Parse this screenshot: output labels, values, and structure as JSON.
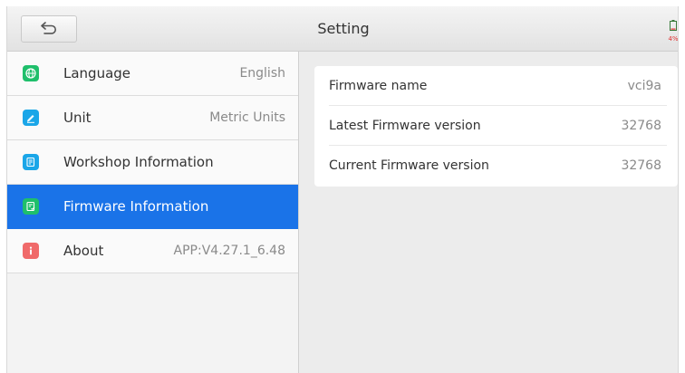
{
  "header": {
    "title": "Setting",
    "back_icon": "back-arrow-icon",
    "battery": "4%"
  },
  "sidebar": {
    "items": [
      {
        "label": "Language",
        "value": "English",
        "icon": "globe-icon",
        "color": "#1fbf6b"
      },
      {
        "label": "Unit",
        "value": "Metric Units",
        "icon": "pencil-icon",
        "color": "#1aa6e8"
      },
      {
        "label": "Workshop Information",
        "value": "",
        "icon": "document-icon",
        "color": "#1aa6e8"
      },
      {
        "label": "Firmware Information",
        "value": "",
        "icon": "document-check-icon",
        "color": "#1fbf6b",
        "active": true
      },
      {
        "label": "About",
        "value": "APP:V4.27.1_6.48",
        "icon": "info-icon",
        "color": "#f06a6a"
      }
    ]
  },
  "firmware": {
    "rows": [
      {
        "label": "Firmware name",
        "value": "vci9a"
      },
      {
        "label": "Latest Firmware version",
        "value": "32768"
      },
      {
        "label": "Current Firmware version",
        "value": "32768"
      }
    ]
  },
  "colors": {
    "accent": "#1a73e8",
    "background": "#ececec"
  }
}
